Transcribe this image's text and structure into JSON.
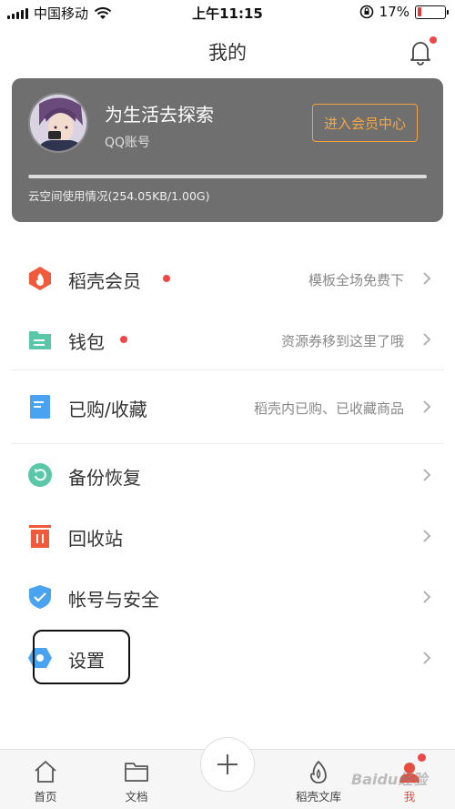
{
  "status_bar": {
    "carrier": "中国移动",
    "time": "上午11:15",
    "battery_percent": "17%",
    "battery_level": 0.17
  },
  "navbar": {
    "title": "我的"
  },
  "profile": {
    "username": "为生活去探索",
    "account_type": "QQ账号",
    "vip_button": "进入会员中心",
    "storage_text": "云空间使用情况(254.05KB/1.00G)",
    "storage_used_fraction": 0.0003
  },
  "menu": [
    {
      "label": "稻壳会员",
      "hint": "模板全场免费下",
      "icon": "daoke-vip-icon",
      "color": "#f05a3a",
      "dot": true
    },
    {
      "label": "钱包",
      "hint": "资源券移到这里了哦",
      "icon": "wallet-icon",
      "color": "#5ac8a8",
      "dot": true
    },
    {
      "label": "已购/收藏",
      "hint": "稻壳内已购、已收藏商品",
      "icon": "purchased-icon",
      "color": "#4aa3f0",
      "dot": false
    },
    {
      "label": "备份恢复",
      "hint": "",
      "icon": "backup-icon",
      "color": "#5ac8a8",
      "dot": false
    },
    {
      "label": "回收站",
      "hint": "",
      "icon": "recycle-bin-icon",
      "color": "#f05a3a",
      "dot": false
    },
    {
      "label": "帐号与安全",
      "hint": "",
      "icon": "shield-icon",
      "color": "#4aa3f0",
      "dot": false
    },
    {
      "label": "设置",
      "hint": "",
      "icon": "settings-icon",
      "color": "#4aa3f0",
      "dot": false
    }
  ],
  "tabs": [
    {
      "label": "首页",
      "icon": "home-icon"
    },
    {
      "label": "文档",
      "icon": "folder-icon"
    },
    {
      "label": "",
      "icon": "plus-icon"
    },
    {
      "label": "稻壳文库",
      "icon": "daoke-library-icon"
    },
    {
      "label": "我",
      "icon": "me-icon"
    }
  ],
  "watermark": "Baidu经验"
}
